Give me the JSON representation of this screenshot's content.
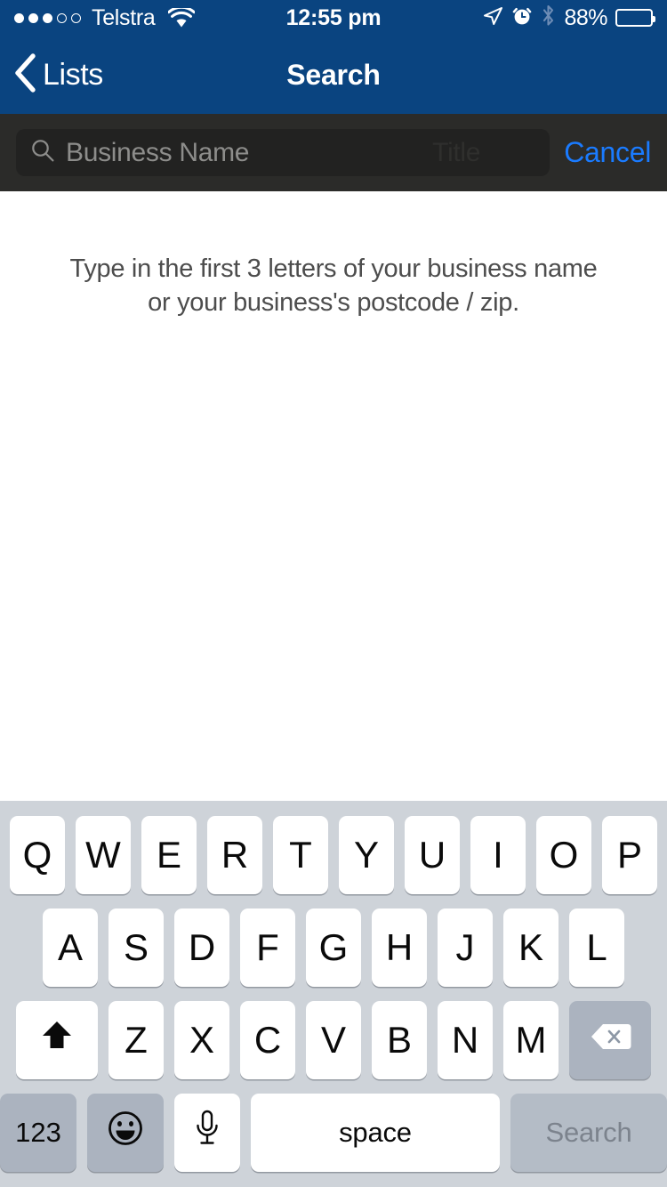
{
  "status_bar": {
    "carrier": "Telstra",
    "signal_filled": 3,
    "signal_total": 5,
    "time": "12:55 pm",
    "battery_percent": "88%",
    "battery_level": 88,
    "icons": [
      "location-arrow-icon",
      "alarm-clock-icon",
      "bluetooth-icon"
    ],
    "background_color": "#0a4480"
  },
  "nav_bar": {
    "back_label": "Lists",
    "title": "Search",
    "background_color": "#0a4480",
    "text_color": "#ffffff"
  },
  "search_bar": {
    "placeholder": "Business Name",
    "value": "",
    "watermark": "Title",
    "cancel_label": "Cancel",
    "cancel_color": "#1a7bff",
    "background_color": "#2b2b29",
    "field_color": "#222221"
  },
  "content": {
    "hint_line_1": "Type in the first 3 letters of your business name",
    "hint_line_2": "or your business's postcode / zip.",
    "text_color": "#4d4d4d",
    "background_color": "#ffffff"
  },
  "keyboard": {
    "background_color": "#ced3d9",
    "key_color": "#ffffff",
    "special_key_color": "#abb3bf",
    "row1": [
      "Q",
      "W",
      "E",
      "R",
      "T",
      "Y",
      "U",
      "I",
      "O",
      "P"
    ],
    "row2": [
      "A",
      "S",
      "D",
      "F",
      "G",
      "H",
      "J",
      "K",
      "L"
    ],
    "row3": [
      "Z",
      "X",
      "C",
      "V",
      "B",
      "N",
      "M"
    ],
    "shift_key": "shift-icon",
    "delete_key": "delete-icon",
    "numeric_key": "123",
    "emoji_key": "emoji-icon",
    "mic_key": "microphone-icon",
    "space_key": "space",
    "search_key": "Search",
    "search_key_enabled": false
  }
}
